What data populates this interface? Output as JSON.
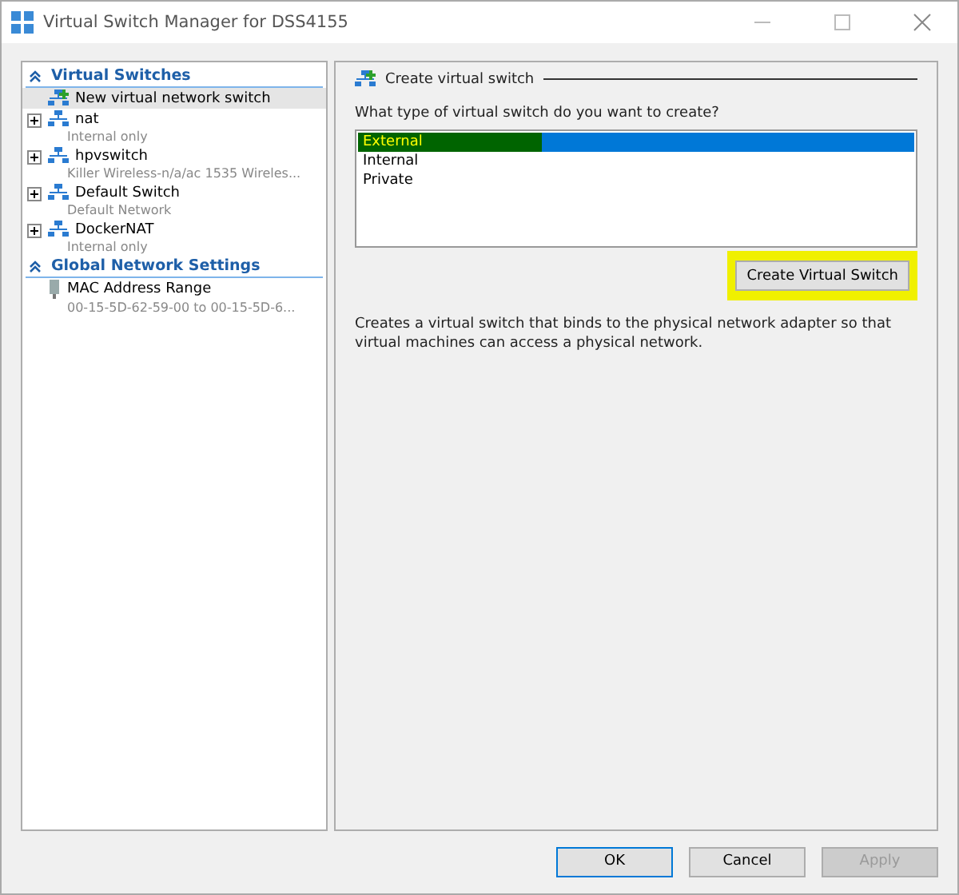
{
  "window": {
    "title": "Virtual Switch Manager for DSS4155"
  },
  "sidebar": {
    "sections": [
      {
        "title": "Virtual Switches",
        "items": [
          {
            "kind": "new",
            "name": "New virtual network switch",
            "selected": true
          },
          {
            "kind": "switch",
            "name": "nat",
            "detail": "Internal only",
            "expanded": false,
            "selected": false
          },
          {
            "kind": "switch",
            "name": "hpvswitch",
            "detail": "Killer Wireless-n/a/ac 1535 Wireles...",
            "expanded": false,
            "selected": false
          },
          {
            "kind": "switch",
            "name": "Default Switch",
            "detail": "Default Network",
            "expanded": false,
            "selected": false
          },
          {
            "kind": "switch",
            "name": "DockerNAT",
            "detail": "Internal only",
            "expanded": false,
            "selected": false
          }
        ]
      },
      {
        "title": "Global Network Settings",
        "items": [
          {
            "kind": "mac",
            "name": "MAC Address Range",
            "detail": "00-15-5D-62-59-00 to 00-15-5D-6...",
            "selected": false
          }
        ]
      }
    ]
  },
  "panel": {
    "title": "Create virtual switch",
    "question": "What type of virtual switch do you want to create?",
    "options": [
      {
        "label": "External",
        "selected": true,
        "highlighted": true
      },
      {
        "label": "Internal",
        "selected": false,
        "highlighted": false
      },
      {
        "label": "Private",
        "selected": false,
        "highlighted": false
      }
    ],
    "create_button": {
      "label": "Create Virtual Switch",
      "highlighted": true
    },
    "description": "Creates a virtual switch that binds to the physical network adapter so that virtual machines can access a physical network."
  },
  "buttons": [
    {
      "label": "OK",
      "default": true,
      "disabled": false
    },
    {
      "label": "Cancel",
      "default": false,
      "disabled": false
    },
    {
      "label": "Apply",
      "default": false,
      "disabled": true
    }
  ]
}
